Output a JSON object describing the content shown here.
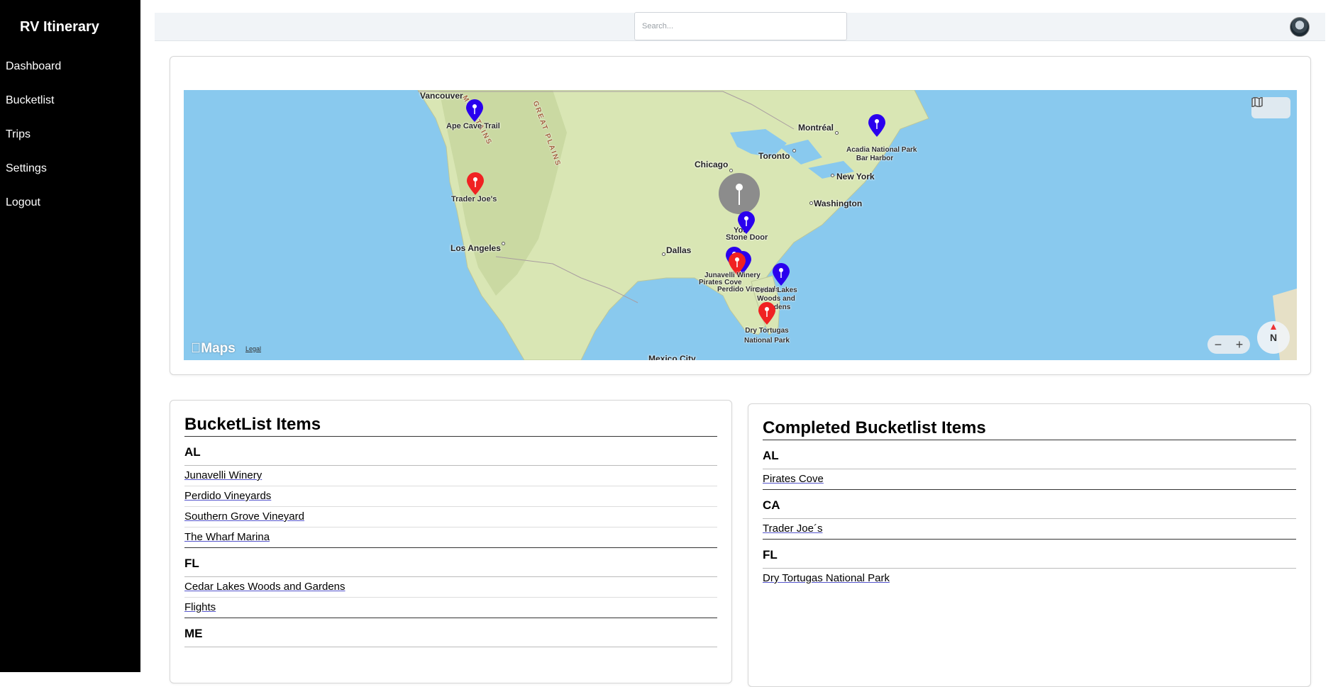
{
  "app": {
    "title": "RV Itinerary"
  },
  "sidebar": {
    "items": [
      {
        "label": "Dashboard"
      },
      {
        "label": "Bucketlist"
      },
      {
        "label": "Trips"
      },
      {
        "label": "Settings"
      },
      {
        "label": "Logout"
      }
    ]
  },
  "search": {
    "placeholder": "Search..."
  },
  "map": {
    "region_labels": [
      "MOUNTAINS",
      "GREAT PLAINS"
    ],
    "cities": [
      {
        "name": "Vancouver"
      },
      {
        "name": "Los Angeles"
      },
      {
        "name": "Dallas"
      },
      {
        "name": "Chicago"
      },
      {
        "name": "Toronto"
      },
      {
        "name": "Montréal"
      },
      {
        "name": "New York"
      },
      {
        "name": "Washington"
      },
      {
        "name": "Mexico City"
      }
    ],
    "pins": [
      {
        "label": "Ape Cave Trail",
        "color": "#2a00ee"
      },
      {
        "label": "Trader Joe's",
        "color": "#f02222"
      },
      {
        "label": "Acadia National Park",
        "color": "#2a00ee"
      },
      {
        "label": "Bar Harbor",
        "color": "#2a00ee"
      },
      {
        "label": "Stone Door",
        "color": "#2a00ee"
      },
      {
        "label": "You",
        "color": "#888888"
      },
      {
        "label": "Junavelli Winery",
        "color": "#2a00ee"
      },
      {
        "label": "Pirates Cove",
        "color": "#f02222"
      },
      {
        "label": "Perdido Vineyards",
        "color": "#2a00ee"
      },
      {
        "label": "Cedar Lakes Woods and Gardens",
        "color": "#2a00ee"
      },
      {
        "label": "Dry Tortugas National Park",
        "color": "#f02222"
      }
    ],
    "attribution": "Maps",
    "legal": "Legal",
    "compass": "N",
    "zoom_out": "−",
    "zoom_in": "+",
    "map_type_icon": "map-icon"
  },
  "bucketlist": {
    "title": "BucketList Items",
    "groups": [
      {
        "state": "AL",
        "items": [
          "Junavelli Winery",
          "Perdido Vineyards",
          "Southern Grove Vineyard",
          "The Wharf Marina"
        ]
      },
      {
        "state": "FL",
        "items": [
          "Cedar Lakes Woods and Gardens",
          "Flights"
        ]
      },
      {
        "state": "ME",
        "items": []
      }
    ]
  },
  "completed": {
    "title": "Completed Bucketlist Items",
    "groups": [
      {
        "state": "AL",
        "items": [
          "Pirates Cove"
        ]
      },
      {
        "state": "CA",
        "items": [
          "Trader Joe´s"
        ]
      },
      {
        "state": "FL",
        "items": [
          "Dry Tortugas National Park"
        ]
      }
    ]
  }
}
